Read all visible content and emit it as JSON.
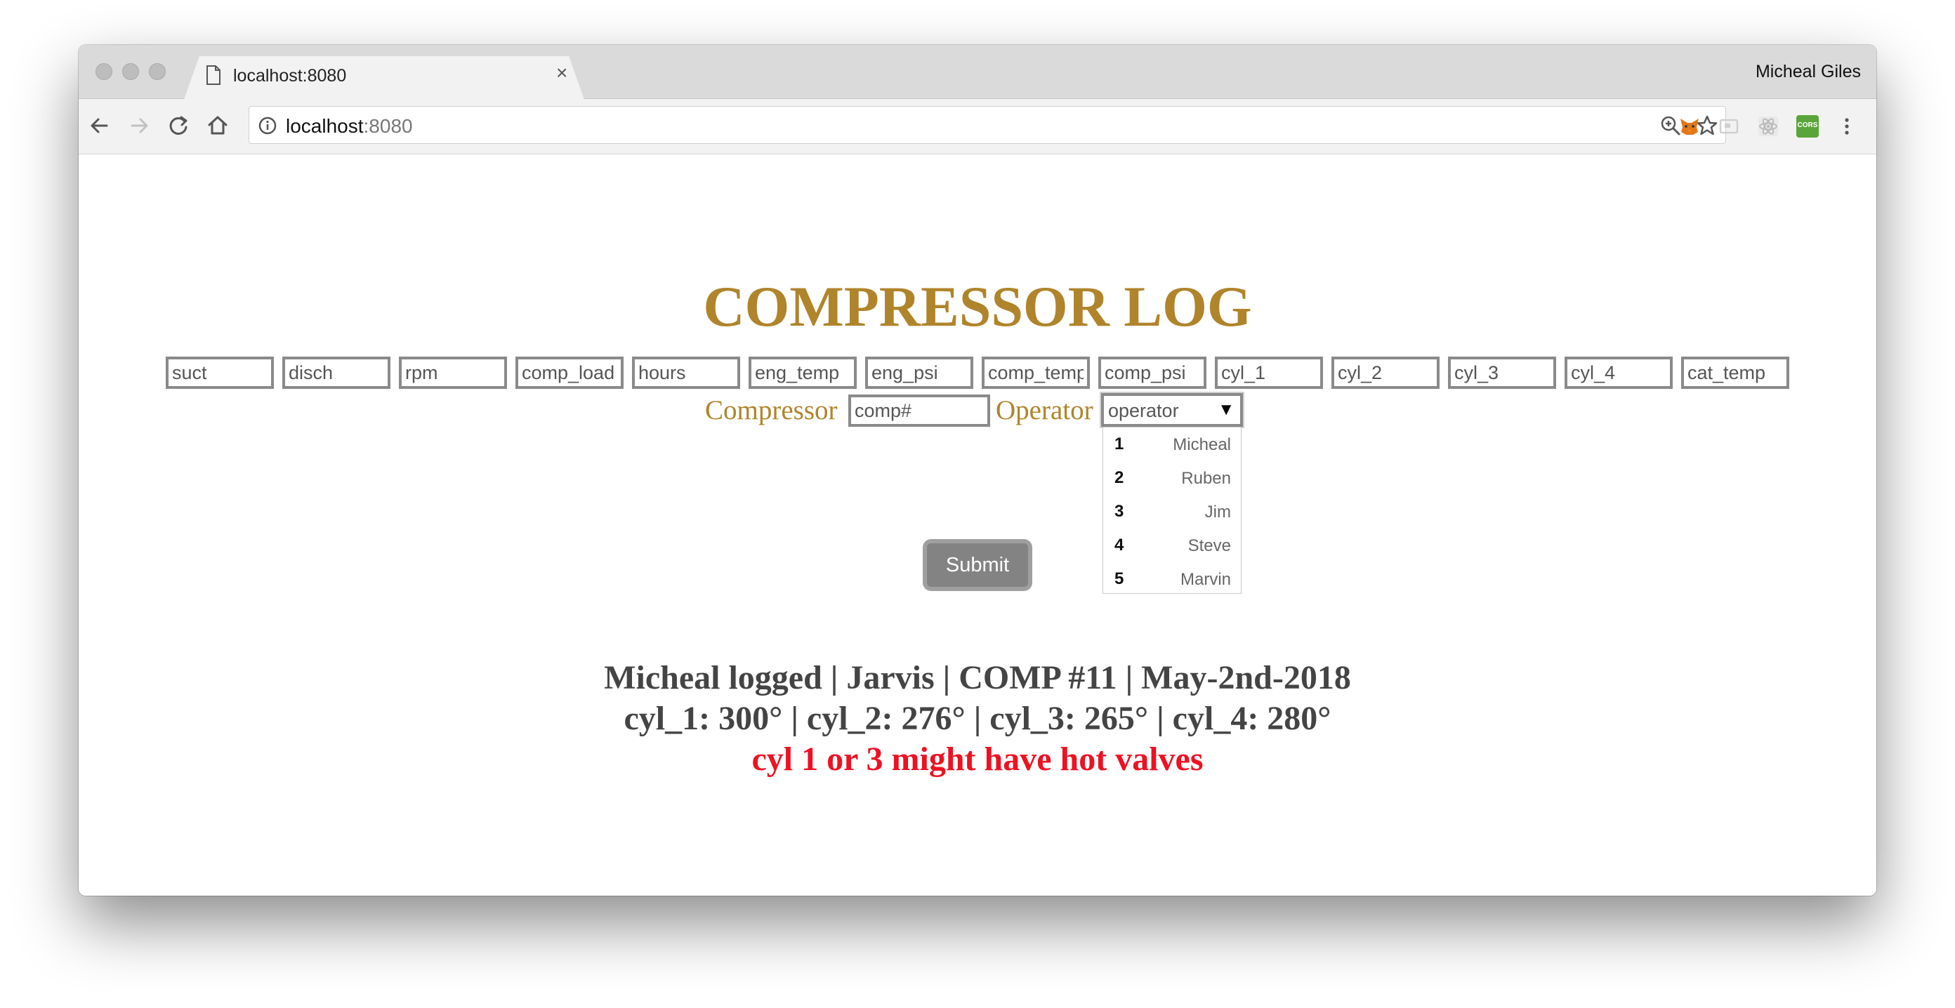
{
  "browser": {
    "tab_title": "localhost:8080",
    "tab_close": "×",
    "profile_name": "Micheal Giles",
    "address": {
      "host": "localhost",
      "port": ":8080"
    },
    "extensions": [
      "metamask-icon",
      "cast-icon",
      "react-devtools-icon",
      "cors-icon"
    ],
    "cors_label": "CORS"
  },
  "page": {
    "title": "COMPRESSOR LOG",
    "fields": [
      "suct",
      "disch",
      "rpm",
      "comp_load",
      "hours",
      "eng_temp",
      "eng_psi",
      "comp_temp",
      "comp_psi",
      "cyl_1",
      "cyl_2",
      "cyl_3",
      "cyl_4",
      "cat_temp"
    ],
    "compressor_label": "Compressor",
    "compressor_placeholder": "comp#",
    "operator_label": "Operator",
    "operator_selected": "operator",
    "operator_caret": "▼",
    "operators": [
      {
        "num": "1",
        "name": "Micheal"
      },
      {
        "num": "2",
        "name": "Ruben"
      },
      {
        "num": "3",
        "name": "Jim"
      },
      {
        "num": "4",
        "name": "Steve"
      },
      {
        "num": "5",
        "name": "Marvin"
      }
    ],
    "submit_label": "Submit",
    "summary_line1": "Micheal logged | Jarvis | COMP #11 | May-2nd-2018",
    "summary_line2": "cyl_1: 300° | cyl_2: 276° | cyl_3: 265° | cyl_4: 280°",
    "warning": "cyl 1 or 3 might have hot valves"
  },
  "colors": {
    "title": "#b0842b",
    "warning": "#ee1122",
    "summary": "#444444",
    "field_border": "#8a8a8a",
    "cors_badge": "#5aa53a"
  }
}
